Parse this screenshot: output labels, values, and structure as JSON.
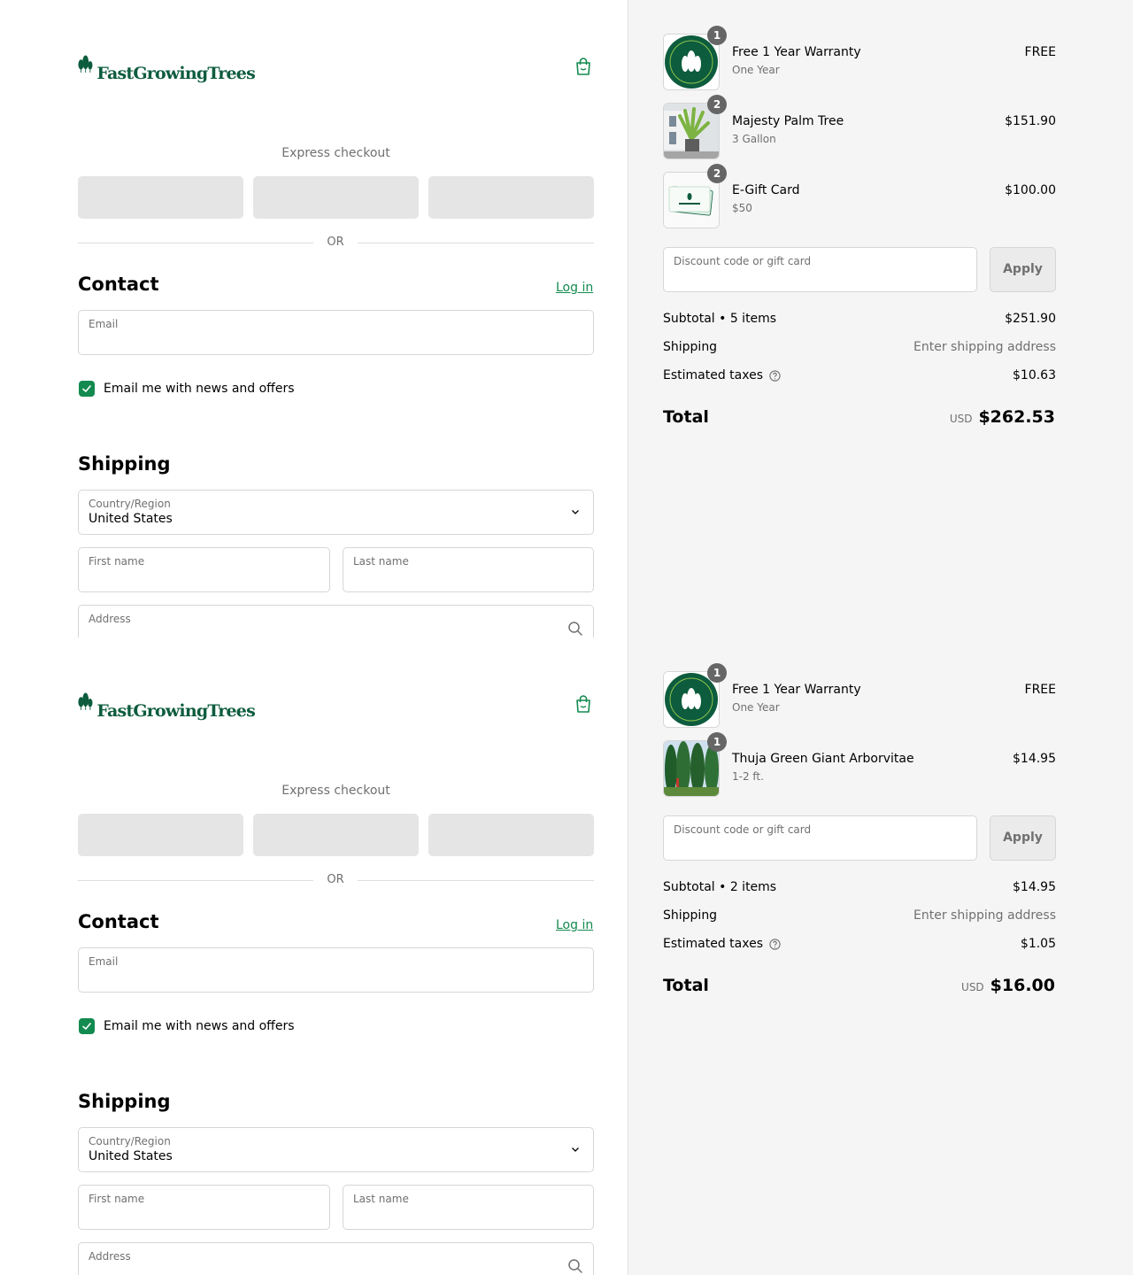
{
  "colors": {
    "brand_green": "#0d5c3e",
    "accent_green": "#138a4f",
    "summary_bg": "#f5f5f5",
    "express_button_bg": "#e5e5e5",
    "quantity_badge": "#666666"
  },
  "icons": {
    "logo": "tree-logo-icon",
    "cart": "shopping-bag-icon",
    "checkbox": "check-icon",
    "country_select": "chevron-down-icon",
    "address_search": "search-icon",
    "taxes_info": "question-circle-icon"
  },
  "panes": [
    {
      "header": {
        "brand": "FastGrowingTrees"
      },
      "express": {
        "label": "Express checkout",
        "divider": "OR"
      },
      "contact": {
        "heading": "Contact",
        "login_label": "Log in",
        "email_label": "Email",
        "email_value": "",
        "newsletter_label": "Email me with news and offers",
        "newsletter_checked": true
      },
      "shipping": {
        "heading": "Shipping",
        "country_label": "Country/Region",
        "country_value": "United States",
        "first_name_label": "First name",
        "last_name_label": "Last name",
        "address_label": "Address"
      },
      "summary": {
        "items": [
          {
            "name": "Free 1 Year Warranty",
            "variant": "One Year",
            "price": "FREE",
            "quantity": "1",
            "image": "warranty-badge"
          },
          {
            "name": "Majesty Palm Tree",
            "variant": "3 Gallon",
            "price": "$151.90",
            "quantity": "2",
            "image": "palm-tree"
          },
          {
            "name": "E-Gift Card",
            "variant": "$50",
            "price": "$100.00",
            "quantity": "2",
            "image": "gift-card"
          }
        ],
        "discount_placeholder": "Discount code or gift card",
        "apply_label": "Apply",
        "subtotal_label": "Subtotal • 5 items",
        "subtotal_value": "$251.90",
        "shipping_label": "Shipping",
        "shipping_value": "Enter shipping address",
        "taxes_label": "Estimated taxes",
        "taxes_value": "$10.63",
        "total_label": "Total",
        "currency": "USD",
        "total_value": "$262.53"
      }
    },
    {
      "header": {
        "brand": "FastGrowingTrees"
      },
      "express": {
        "label": "Express checkout",
        "divider": "OR"
      },
      "contact": {
        "heading": "Contact",
        "login_label": "Log in",
        "email_label": "Email",
        "email_value": "",
        "newsletter_label": "Email me with news and offers",
        "newsletter_checked": true
      },
      "shipping": {
        "heading": "Shipping",
        "country_label": "Country/Region",
        "country_value": "United States",
        "first_name_label": "First name",
        "last_name_label": "Last name",
        "address_label": "Address"
      },
      "summary": {
        "items": [
          {
            "name": "Free 1 Year Warranty",
            "variant": "One Year",
            "price": "FREE",
            "quantity": "1",
            "image": "warranty-badge"
          },
          {
            "name": "Thuja Green Giant Arborvitae",
            "variant": "1-2 ft.",
            "price": "$14.95",
            "quantity": "1",
            "image": "arborvitae-hedge"
          }
        ],
        "discount_placeholder": "Discount code or gift card",
        "apply_label": "Apply",
        "subtotal_label": "Subtotal • 2 items",
        "subtotal_value": "$14.95",
        "shipping_label": "Shipping",
        "shipping_value": "Enter shipping address",
        "taxes_label": "Estimated taxes",
        "taxes_value": "$1.05",
        "total_label": "Total",
        "currency": "USD",
        "total_value": "$16.00"
      }
    }
  ]
}
